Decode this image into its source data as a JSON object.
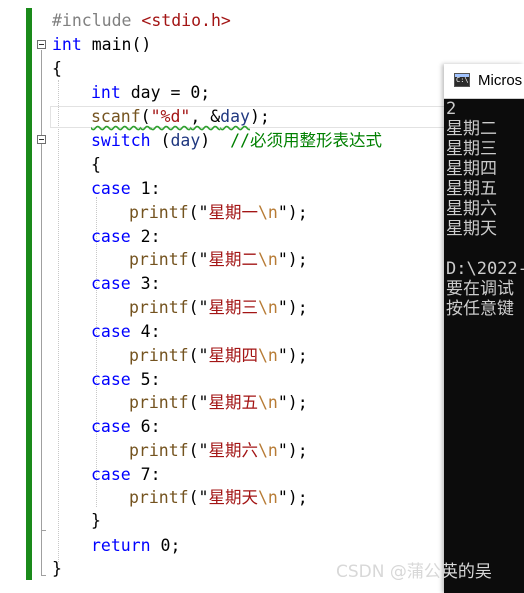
{
  "editor": {
    "line1": {
      "directive": "#include",
      "header": "<stdio.h>"
    },
    "line2": {
      "type": "int",
      "name": " main()"
    },
    "line3": {
      "text": "{"
    },
    "line4": {
      "type": "int",
      "rest": " day = 0;"
    },
    "line5": {
      "call": "scanf",
      "open": "(",
      "fmt": "\"%d\"",
      "comma": ", &",
      "arg": "day",
      "close": ");"
    },
    "line6": {
      "keyword": "switch",
      "open": " (",
      "arg": "day",
      "close": ")  ",
      "comment": "//必须用整形表达式"
    },
    "line7": {
      "text": "{"
    },
    "cases": [
      {
        "keyword": "case",
        "label": " 1:",
        "call": "printf",
        "q1": "(\"",
        "text": "星期一",
        "esc": "\\n",
        "q2": "\");"
      },
      {
        "keyword": "case",
        "label": " 2:",
        "call": "printf",
        "q1": "(\"",
        "text": "星期二",
        "esc": "\\n",
        "q2": "\");"
      },
      {
        "keyword": "case",
        "label": " 3:",
        "call": "printf",
        "q1": "(\"",
        "text": "星期三",
        "esc": "\\n",
        "q2": "\");"
      },
      {
        "keyword": "case",
        "label": " 4:",
        "call": "printf",
        "q1": "(\"",
        "text": "星期四",
        "esc": "\\n",
        "q2": "\");"
      },
      {
        "keyword": "case",
        "label": " 5:",
        "call": "printf",
        "q1": "(\"",
        "text": "星期五",
        "esc": "\\n",
        "q2": "\");"
      },
      {
        "keyword": "case",
        "label": " 6:",
        "call": "printf",
        "q1": "(\"",
        "text": "星期六",
        "esc": "\\n",
        "q2": "\");"
      },
      {
        "keyword": "case",
        "label": " 7:",
        "call": "printf",
        "q1": "(\"",
        "text": "星期天",
        "esc": "\\n",
        "q2": "\");"
      }
    ],
    "close_switch": "}",
    "return": {
      "keyword": "return",
      "rest": " 0;"
    },
    "close_main": "}"
  },
  "console": {
    "title": "Micros",
    "icon_label": "C:\\",
    "output": [
      "2",
      "星期二",
      "星期三",
      "星期四",
      "星期五",
      "星期六",
      "星期天",
      "",
      "D:\\2022-",
      "要在调试",
      "按任意键"
    ]
  },
  "watermark": "CSDN @蒲公英的吴",
  "colors": {
    "keyword": "#0000ff",
    "string": "#a31515",
    "comment": "#008000",
    "preprocessor": "#808080",
    "escape": "#b77b35",
    "change_bar": "#1a8a1a",
    "console_bg": "#0c0c0c"
  },
  "icons": [
    "collapse-icon",
    "console-app-icon"
  ]
}
